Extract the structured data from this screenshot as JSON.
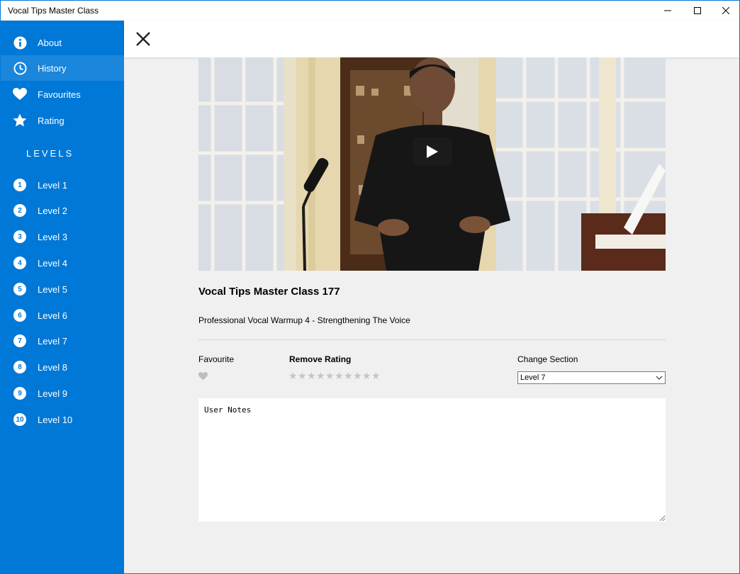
{
  "window": {
    "title": "Vocal Tips  Master Class",
    "controls": [
      "minimize-icon",
      "maximize-icon",
      "close-icon"
    ]
  },
  "sidebar": {
    "menu": [
      {
        "label": "About",
        "icon": "info-icon"
      },
      {
        "label": "History",
        "icon": "clock-icon"
      },
      {
        "label": "Favourites",
        "icon": "heart-icon"
      },
      {
        "label": "Rating",
        "icon": "star-icon"
      }
    ],
    "levels_heading": "LEVELS",
    "levels": [
      {
        "num": "1",
        "label": "Level 1"
      },
      {
        "num": "2",
        "label": "Level 2"
      },
      {
        "num": "3",
        "label": "Level 3"
      },
      {
        "num": "4",
        "label": "Level 4"
      },
      {
        "num": "5",
        "label": "Level 5"
      },
      {
        "num": "6",
        "label": "Level 6"
      },
      {
        "num": "7",
        "label": "Level 7"
      },
      {
        "num": "8",
        "label": "Level 8"
      },
      {
        "num": "9",
        "label": "Level 9"
      },
      {
        "num": "10",
        "label": "Level 10"
      }
    ]
  },
  "video": {
    "title": "Vocal Tips Master Class 177",
    "subtitle": "Professional Vocal Warmup 4 - Strengthening The Voice"
  },
  "controls": {
    "favourite_label": "Favourite",
    "rating_label": "Remove Rating",
    "rating_value": 0,
    "rating_max": 10,
    "section_label": "Change Section",
    "section_selected": "Level 7"
  },
  "notes": {
    "value": "User Notes"
  },
  "colors": {
    "accent": "#0078d7",
    "inactive_icon": "#c4c4c4"
  }
}
